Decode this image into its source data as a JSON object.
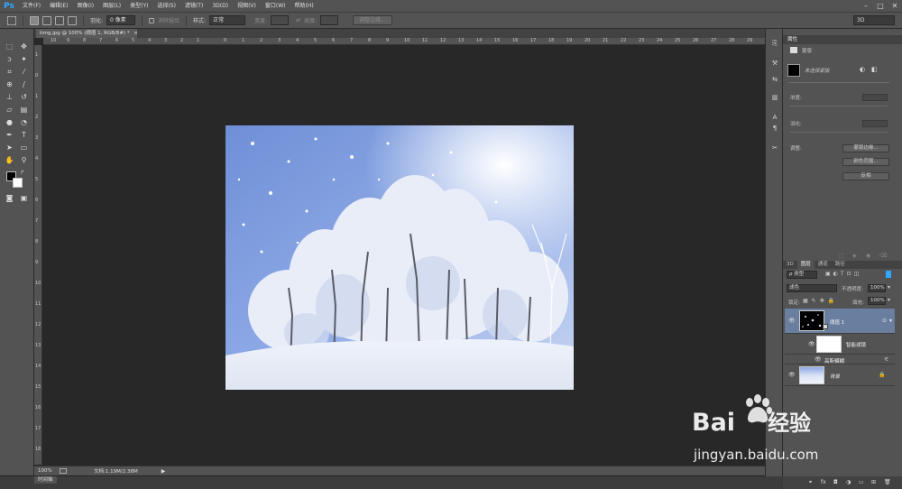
{
  "app": {
    "logo": "Ps"
  },
  "menu": {
    "items": [
      "文件(F)",
      "编辑(E)",
      "图像(I)",
      "图层(L)",
      "类型(Y)",
      "选择(S)",
      "滤镜(T)",
      "3D(D)",
      "视图(V)",
      "窗口(W)",
      "帮助(H)"
    ]
  },
  "window_controls": {
    "minimize": "–",
    "maximize": "□",
    "close": "✕"
  },
  "options": {
    "feather_label": "羽化:",
    "feather_value": "0 像素",
    "antialias_label": "消除锯齿",
    "style_label": "样式:",
    "style_value": "正常",
    "width_label": "宽度:",
    "height_label": "高度:",
    "refine_edge": "调整边缘...",
    "workspace": "3D"
  },
  "document": {
    "tab_title": "timg.jpg @ 100% (阈值 1, RGB/8#) *",
    "close": "×"
  },
  "ruler_top": [
    "10",
    "9",
    "8",
    "7",
    "6",
    "5",
    "4",
    "3",
    "2",
    "1",
    "0",
    "1",
    "2",
    "3",
    "4",
    "5",
    "6",
    "7",
    "8",
    "9",
    "10",
    "11",
    "12",
    "13",
    "14",
    "15",
    "16",
    "17",
    "18",
    "19",
    "20",
    "21",
    "22",
    "23",
    "24",
    "25",
    "26",
    "27",
    "28",
    "29"
  ],
  "ruler_left": [
    "1",
    "0",
    "1",
    "2",
    "3",
    "4",
    "5",
    "6",
    "7",
    "8",
    "9",
    "10",
    "11",
    "12",
    "13",
    "14",
    "15",
    "16",
    "17",
    "18"
  ],
  "status": {
    "zoom": "100%",
    "doc_info": "文档:1.19M/2.38M",
    "arrow": "▶"
  },
  "timeline": {
    "tab": "时间轴"
  },
  "properties": {
    "title": "属性",
    "mask_label": "蒙版",
    "mask_kind": "未选择蒙版",
    "density_label": "浓度:",
    "feather_label": "羽化:",
    "refine_label": "调整:",
    "mask_edge_button": "蒙版边缘...",
    "color_range_button": "颜色范围...",
    "invert_button": "反相"
  },
  "layers": {
    "tabs": [
      "3D",
      "图层",
      "通道",
      "路径"
    ],
    "active_tab": "图层",
    "filter_kind": "ρ 类型",
    "blend_mode": "滤色",
    "opacity_label": "不透明度:",
    "opacity_value": "100%",
    "lock_label": "锁定:",
    "fill_label": "填充:",
    "fill_value": "100%",
    "list": [
      {
        "name": "阈值 1",
        "kind": "smart"
      },
      {
        "name": "智能滤镜",
        "kind": "filter-group"
      },
      {
        "name": "高斯模糊",
        "kind": "filter"
      },
      {
        "name": "背景",
        "kind": "background"
      }
    ]
  },
  "watermark": {
    "brand_latin": "Bai",
    "brand_cn": "经验",
    "url": "jingyan.baidu.com"
  },
  "colors": {
    "ui_panel": "#535353",
    "canvas_bg": "#282828",
    "selection": "#6a7ea0",
    "ps_blue": "#31a8ff"
  }
}
